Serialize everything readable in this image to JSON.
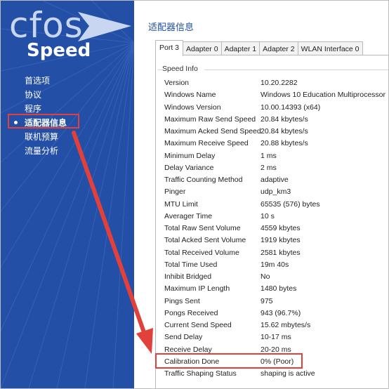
{
  "logo": {
    "line1": "cfos",
    "line2": "Speed"
  },
  "nav": {
    "items": [
      {
        "label": "首选项"
      },
      {
        "label": "协议"
      },
      {
        "label": "程序"
      },
      {
        "label": "适配器信息"
      },
      {
        "label": "联机预算"
      },
      {
        "label": "流量分析"
      }
    ],
    "active_index": 3
  },
  "page": {
    "title": "适配器信息"
  },
  "tabs": [
    {
      "label": "Port 3",
      "active": true
    },
    {
      "label": "Adapter 0"
    },
    {
      "label": "Adapter 1"
    },
    {
      "label": "Adapter 2"
    },
    {
      "label": "WLAN Interface 0"
    }
  ],
  "speed_info": {
    "title": "Speed Info",
    "rows": [
      {
        "key": "Version",
        "value": "10.20.2282"
      },
      {
        "key": "Windows Name",
        "value": "Windows 10 Education Multiprocessor"
      },
      {
        "key": "Windows Version",
        "value": "10.00.14393 (x64)"
      },
      {
        "key": "Maximum Raw Send Speed",
        "value": "20.84 kbytes/s"
      },
      {
        "key": "Maximum Acked Send Speed",
        "value": "20.84 kbytes/s"
      },
      {
        "key": "Maximum Receive Speed",
        "value": "20.88 kbytes/s"
      },
      {
        "key": "Minimum Delay",
        "value": "1 ms"
      },
      {
        "key": "Delay Variance",
        "value": "2 ms"
      },
      {
        "key": "Traffic Counting Method",
        "value": "adaptive"
      },
      {
        "key": "Pinger",
        "value": "udp_km3"
      },
      {
        "key": "MTU Limit",
        "value": "65535 (576) bytes"
      },
      {
        "key": "Averager Time",
        "value": "10 s"
      },
      {
        "key": "Total Raw Sent Volume",
        "value": "4559 kbytes"
      },
      {
        "key": "Total Acked Sent Volume",
        "value": "1919 kbytes"
      },
      {
        "key": "Total Received Volume",
        "value": "2581 kbytes"
      },
      {
        "key": "Total Time Used",
        "value": "19m 40s"
      },
      {
        "key": "Inhibit Bridged",
        "value": "No"
      },
      {
        "key": "Maximum IP Length",
        "value": "1480 bytes"
      },
      {
        "key": "Pings Sent",
        "value": "975"
      },
      {
        "key": "Pongs Received",
        "value": "943 (96.7%)"
      },
      {
        "key": "Current Send Speed",
        "value": "15.62 mbytes/s"
      },
      {
        "key": "Send Delay",
        "value": "10-17 ms"
      },
      {
        "key": "Receive Delay",
        "value": "20-20 ms"
      },
      {
        "key": "Calibration Done",
        "value": "0% (Poor)"
      },
      {
        "key": "Traffic Shaping Status",
        "value": "shaping is active"
      }
    ]
  },
  "colors": {
    "sidebar": "#2350a6",
    "title": "#1f4fa6",
    "highlight": "#e2403a"
  }
}
